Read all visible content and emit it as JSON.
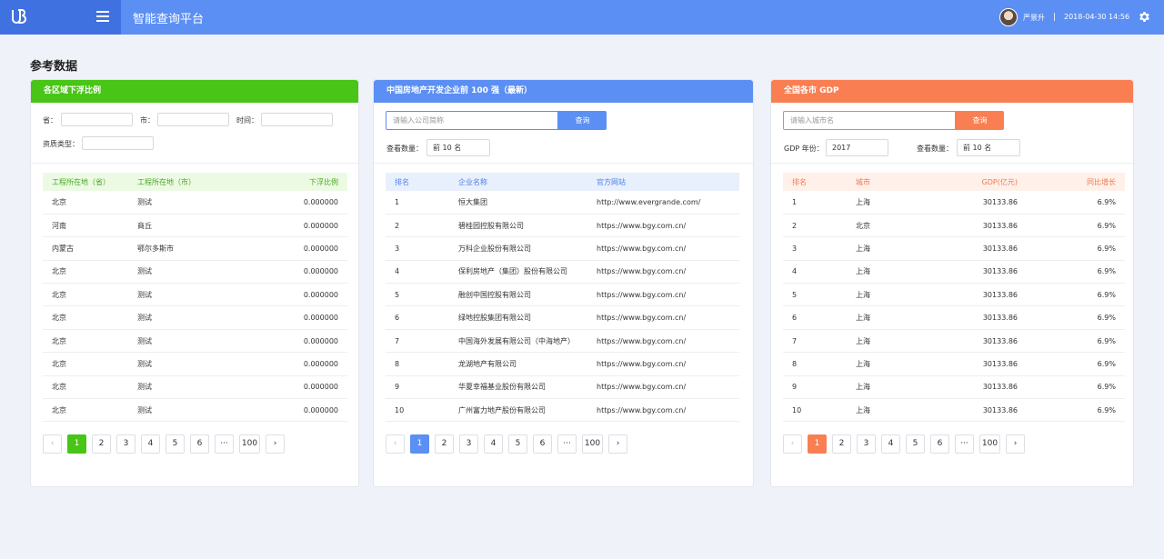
{
  "header": {
    "title": "智能查询平台",
    "username": "严景升",
    "datetime": "2018-04-30 14:56"
  },
  "page_title": "参考数据",
  "colors": {
    "topbar": "#5b8ff4",
    "logo_block": "#3f71e0",
    "green": "#48c516",
    "blue": "#5b8ff4",
    "orange": "#f97f53"
  },
  "icons": [
    "logo-icon",
    "menu-icon",
    "avatar",
    "gear-icon",
    "chevron-left-icon",
    "chevron-right-icon"
  ],
  "card1": {
    "title": "各区域下浮比例",
    "filters": {
      "province": "省：",
      "city": "市：",
      "time": "时间：",
      "qualification": "资质类型："
    },
    "columns": [
      "工程所在地（省）",
      "工程所在地（市）",
      "下浮比例"
    ],
    "rows": [
      [
        "北京",
        "测试",
        "0.000000"
      ],
      [
        "河南",
        "商丘",
        "0.000000"
      ],
      [
        "内蒙古",
        "鄂尔多斯市",
        "0.000000"
      ],
      [
        "北京",
        "测试",
        "0.000000"
      ],
      [
        "北京",
        "测试",
        "0.000000"
      ],
      [
        "北京",
        "测试",
        "0.000000"
      ],
      [
        "北京",
        "测试",
        "0.000000"
      ],
      [
        "北京",
        "测试",
        "0.000000"
      ],
      [
        "北京",
        "测试",
        "0.000000"
      ],
      [
        "北京",
        "测试",
        "0.000000"
      ]
    ]
  },
  "card2": {
    "title": "中国房地产开发企业前 100 强（最新）",
    "search_placeholder": "请输入公司简称",
    "search_label": "查询",
    "count_label": "查看数量：",
    "count_value": "前 10 名",
    "columns": [
      "排名",
      "企业名称",
      "官方网站"
    ],
    "rows": [
      [
        "1",
        "恒大集团",
        "http://www.evergrande.com/"
      ],
      [
        "2",
        "碧桂园控股有限公司",
        "https://www.bgy.com.cn/"
      ],
      [
        "3",
        "万科企业股份有限公司",
        "https://www.bgy.com.cn/"
      ],
      [
        "4",
        "保利房地产（集团）股份有限公司",
        "https://www.bgy.com.cn/"
      ],
      [
        "5",
        "融创中国控股有限公司",
        "https://www.bgy.com.cn/"
      ],
      [
        "6",
        "绿地控股集团有限公司",
        "https://www.bgy.com.cn/"
      ],
      [
        "7",
        "中国海外发展有限公司（中海地产）",
        "https://www.bgy.com.cn/"
      ],
      [
        "8",
        "龙湖地产有限公司",
        "https://www.bgy.com.cn/"
      ],
      [
        "9",
        "华夏幸福基业股份有限公司",
        "https://www.bgy.com.cn/"
      ],
      [
        "10",
        "广州富力地产股份有限公司",
        "https://www.bgy.com.cn/"
      ]
    ]
  },
  "card3": {
    "title": "全国各市 GDP",
    "search_placeholder": "请输入城市名",
    "search_label": "查询",
    "year_label": "GDP 年份：",
    "year_value": "2017",
    "count_label": "查看数量：",
    "count_value": "前 10 名",
    "columns": [
      "排名",
      "城市",
      "GDP(亿元)",
      "同比增长"
    ],
    "rows": [
      [
        "1",
        "上海",
        "30133.86",
        "6.9%"
      ],
      [
        "2",
        "北京",
        "30133.86",
        "6.9%"
      ],
      [
        "3",
        "上海",
        "30133.86",
        "6.9%"
      ],
      [
        "4",
        "上海",
        "30133.86",
        "6.9%"
      ],
      [
        "5",
        "上海",
        "30133.86",
        "6.9%"
      ],
      [
        "6",
        "上海",
        "30133.86",
        "6.9%"
      ],
      [
        "7",
        "上海",
        "30133.86",
        "6.9%"
      ],
      [
        "8",
        "上海",
        "30133.86",
        "6.9%"
      ],
      [
        "9",
        "上海",
        "30133.86",
        "6.9%"
      ],
      [
        "10",
        "上海",
        "30133.86",
        "6.9%"
      ]
    ]
  },
  "pagination": {
    "prev": "‹",
    "next": "›",
    "pages": [
      "1",
      "2",
      "3",
      "4",
      "5",
      "6"
    ],
    "ellipsis": "···",
    "last": "100",
    "active": "1"
  }
}
